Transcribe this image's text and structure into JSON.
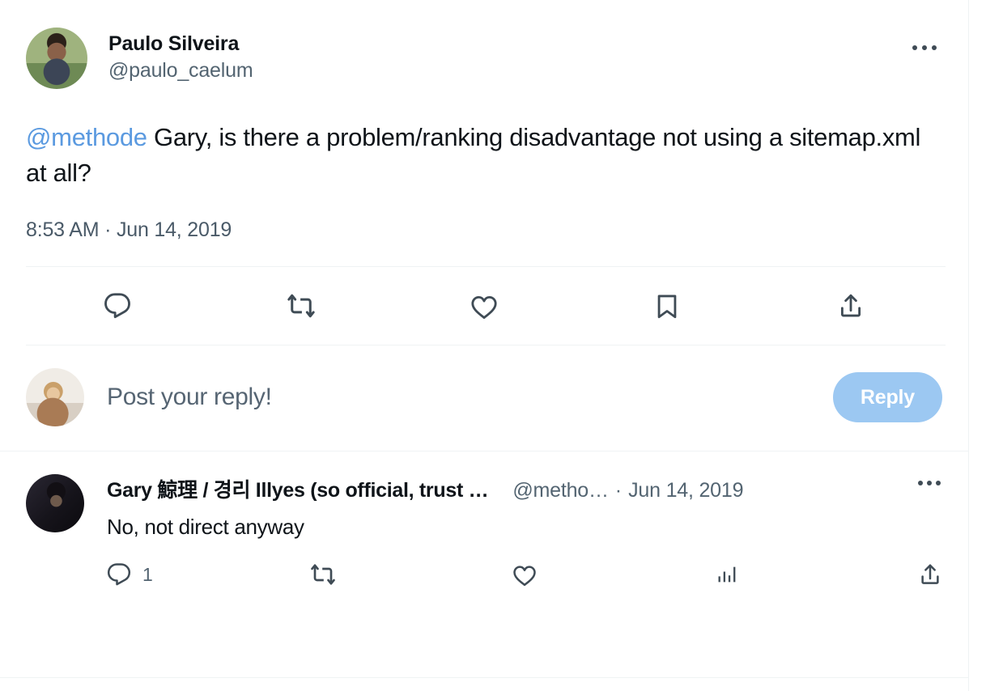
{
  "colors": {
    "text_primary": "#0f1419",
    "text_secondary": "#536471",
    "link_blue": "#5b9ae0",
    "reply_button_bg": "#9cc8f2",
    "divider": "#eff3f4",
    "icon": "#3f4b55"
  },
  "main_tweet": {
    "author_name": "Paulo Silveira",
    "author_handle": "@paulo_caelum",
    "avatar_alt": "paulo-silveira-avatar",
    "more_label": "More",
    "text_mention": "@methode",
    "text_body": " Gary, is there a problem/ranking disadvantage not using a sitemap.xml at all?",
    "timestamp": "8:53 AM · Jun 14, 2019",
    "actions": [
      {
        "name": "reply",
        "icon": "reply-icon",
        "count": ""
      },
      {
        "name": "retweet",
        "icon": "retweet-icon",
        "count": ""
      },
      {
        "name": "like",
        "icon": "heart-icon",
        "count": ""
      },
      {
        "name": "bookmark",
        "icon": "bookmark-icon",
        "count": ""
      },
      {
        "name": "share",
        "icon": "share-icon",
        "count": ""
      }
    ]
  },
  "composer": {
    "avatar_alt": "current-user-avatar",
    "placeholder": "Post your reply!",
    "reply_button_label": "Reply"
  },
  "reply_tweet": {
    "author_name": "Gary 鯨理 / 경리 Illyes (so official, trust …",
    "author_handle": "@metho…",
    "separator": "·",
    "date": "Jun 14, 2019",
    "avatar_alt": "gary-illyes-avatar",
    "more_label": "More",
    "text": "No, not direct anyway",
    "actions": [
      {
        "name": "reply",
        "icon": "reply-icon",
        "count": "1"
      },
      {
        "name": "retweet",
        "icon": "retweet-icon",
        "count": ""
      },
      {
        "name": "like",
        "icon": "heart-icon",
        "count": ""
      },
      {
        "name": "analytics",
        "icon": "analytics-icon",
        "count": ""
      },
      {
        "name": "share",
        "icon": "share-icon",
        "count": ""
      }
    ]
  }
}
